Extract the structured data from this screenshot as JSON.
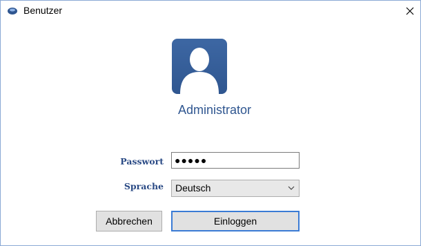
{
  "window": {
    "title": "Benutzer",
    "close_label": "×"
  },
  "user": {
    "name": "Administrator",
    "avatar_color": "#3d67a3"
  },
  "form": {
    "password_label": "Passwort",
    "password_masked": "●●●●●",
    "language_label": "Sprache",
    "language_selected": "Deutsch"
  },
  "buttons": {
    "cancel_label": "Abbrechen",
    "login_label": "Einloggen"
  },
  "colors": {
    "label": "#2a4a85",
    "accent": "#3a7bd5"
  }
}
